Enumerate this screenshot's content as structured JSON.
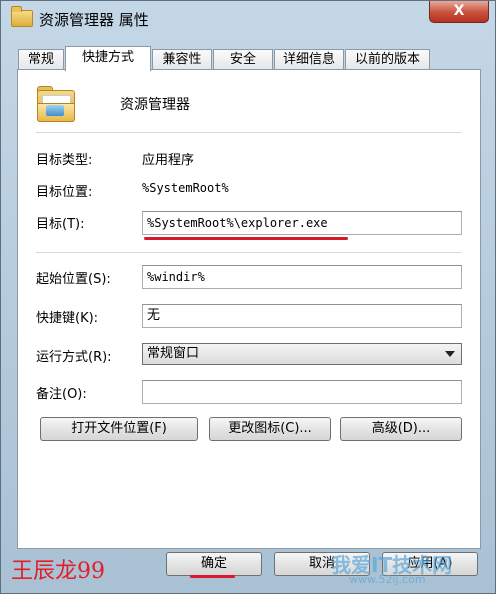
{
  "window": {
    "title": "资源管理器 属性",
    "close_label": "X"
  },
  "tabs": [
    {
      "label": "常规"
    },
    {
      "label": "快捷方式"
    },
    {
      "label": "兼容性"
    },
    {
      "label": "安全"
    },
    {
      "label": "详细信息"
    },
    {
      "label": "以前的版本"
    }
  ],
  "app_name": "资源管理器",
  "info": {
    "target_type_label": "目标类型:",
    "target_type_value": "应用程序",
    "target_location_label": "目标位置:",
    "target_location_value": "%SystemRoot%"
  },
  "fields": {
    "target_label": "目标(T):",
    "target_value": "%SystemRoot%\\explorer.exe",
    "start_in_label": "起始位置(S):",
    "start_in_value": "%windir%",
    "shortcut_key_label": "快捷键(K):",
    "shortcut_key_value": "无",
    "run_label": "运行方式(R):",
    "run_value": "常规窗口",
    "comment_label": "备注(O):",
    "comment_value": ""
  },
  "buttons": {
    "open_location": "打开文件位置(F)",
    "change_icon": "更改图标(C)...",
    "advanced": "高级(D)...",
    "ok": "确定",
    "cancel": "取消",
    "apply": "应用(A)"
  },
  "watermarks": {
    "left": "王辰龙99",
    "right": "我爱IT技术网",
    "url": "www.52ij.com"
  },
  "colors": {
    "highlight_red": "#d6192c"
  }
}
